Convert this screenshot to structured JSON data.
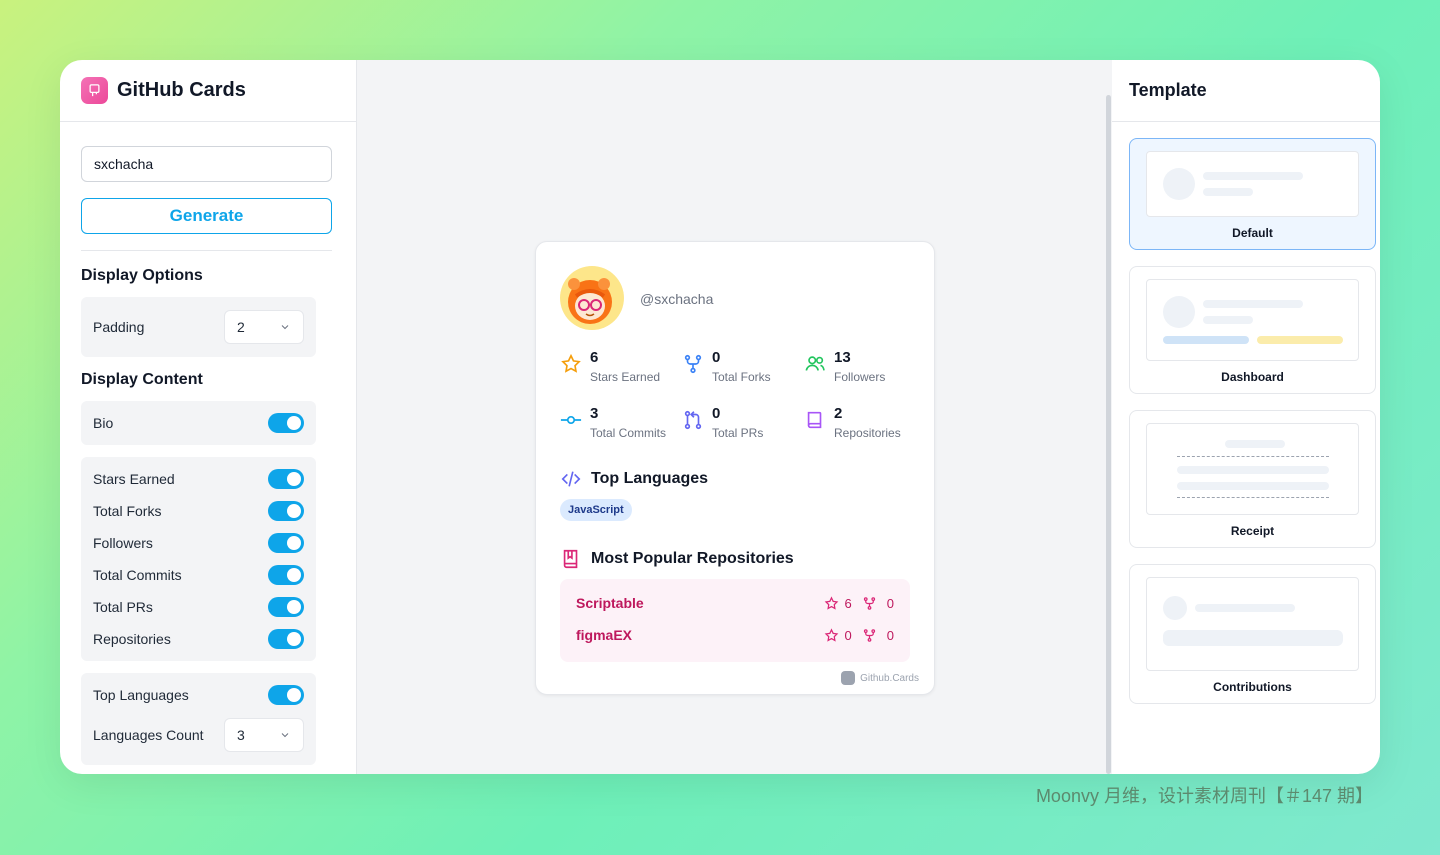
{
  "app": {
    "title": "GitHub Cards"
  },
  "form": {
    "username_value": "sxchacha",
    "generate_label": "Generate"
  },
  "display_options": {
    "title": "Display Options",
    "padding_label": "Padding",
    "padding_value": "2"
  },
  "display_content": {
    "title": "Display Content",
    "bio_label": "Bio",
    "stats_toggles": [
      "Stars Earned",
      "Total Forks",
      "Followers",
      "Total Commits",
      "Total PRs",
      "Repositories"
    ],
    "top_languages_label": "Top Languages",
    "languages_count_label": "Languages Count",
    "languages_count_value": "3"
  },
  "card": {
    "handle": "@sxchacha",
    "stats": [
      {
        "value": "6",
        "label": "Stars Earned",
        "icon": "star-icon"
      },
      {
        "value": "0",
        "label": "Total Forks",
        "icon": "fork-icon"
      },
      {
        "value": "13",
        "label": "Followers",
        "icon": "users-icon"
      },
      {
        "value": "3",
        "label": "Total Commits",
        "icon": "commit-icon"
      },
      {
        "value": "0",
        "label": "Total PRs",
        "icon": "pull-request-icon"
      },
      {
        "value": "2",
        "label": "Repositories",
        "icon": "book-icon"
      }
    ],
    "top_languages_title": "Top Languages",
    "languages": [
      "JavaScript"
    ],
    "popular_repos_title": "Most Popular Repositories",
    "repos": [
      {
        "name": "Scriptable",
        "stars": "6",
        "forks": "0"
      },
      {
        "name": "figmaEX",
        "stars": "0",
        "forks": "0"
      }
    ],
    "footer": "Github.Cards"
  },
  "templates": {
    "title": "Template",
    "items": [
      "Default",
      "Dashboard",
      "Receipt",
      "Contributions"
    ],
    "selected": "Default"
  },
  "watermark": "Moonvy 月维，设计素材周刊【＃147 期】",
  "colors": {
    "accent": "#0ea5e9",
    "brand_pink": "#ec4899",
    "repo_text": "#be185d"
  }
}
